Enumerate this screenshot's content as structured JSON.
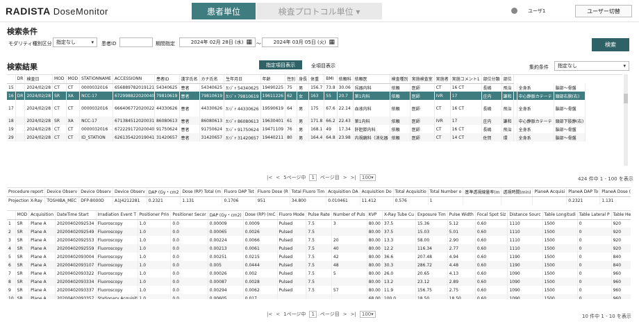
{
  "header": {
    "logo": "RADISTA",
    "product": "DoseMonitor",
    "tabs": [
      {
        "label": "患者単位"
      },
      {
        "label": "検査プロトコル単位 ▾"
      }
    ],
    "user": "ユーザ1",
    "switch_user": "ユーザー切替"
  },
  "search": {
    "title": "検索条件",
    "modality_label": "モダリティ種別区分",
    "modality_value": "指定なし",
    "patient_label": "患者ID",
    "patient_value": "",
    "period_label": "期間指定",
    "date_from": "2024年 02月 28日 (水)",
    "tilde": "〜",
    "date_to": "2024年 03月 05日 (火)",
    "button": "検索"
  },
  "results": {
    "title": "検索結果",
    "show_selected": "指定項目表示",
    "show_all": "全項目表示",
    "agg_label": "集約条件",
    "agg_value": "指定なし"
  },
  "grid1": {
    "headers": [
      "",
      "DR",
      "検査日",
      "MOD",
      "MOD",
      "STATIONNAME",
      "ACCESSIONN",
      "患者ID",
      "漢字氏名",
      "カナ氏名",
      "生年月日",
      "年齢",
      "性別",
      "身長",
      "体重",
      "BMI",
      "依頼科",
      "依頼医",
      "検査種別",
      "実施検査室",
      "実施者",
      "実施コメント1",
      "部位分類",
      "部位"
    ],
    "rows": [
      [
        "15",
        "",
        "2024/02/28",
        "CT",
        "CT",
        "0000032016",
        "656889782019121",
        "54340625",
        "患者",
        "54340625",
        "ｶﾝｼﾞｬ 54340625",
        "19490225",
        "75",
        "男",
        "156.7",
        "73.8",
        "30.06",
        "呉器内科",
        "依頼",
        "医師",
        "CT",
        "16 CT",
        "長嶋",
        "飛治",
        "",
        "全身系",
        "脳部～骨盤"
      ],
      [
        "16",
        "DR",
        "2024/02/28",
        "SR",
        "XA",
        "NCC-17",
        "672998822020040",
        "79810619",
        "患者",
        "79810619",
        "ｶﾝｼﾞｬ 79810619",
        "19611226",
        "62",
        "女",
        "163",
        "55",
        "20.7",
        "第1内科",
        "依頼",
        "医師",
        "IVR",
        "17",
        "庄内",
        "謙和",
        "",
        "中心静脈カテーテ",
        "頸部右腕(右)"
      ],
      [
        "17",
        "",
        "2024/02/28",
        "CT",
        "CT",
        "0000032016",
        "666406772020022",
        "44330626",
        "患者",
        "44330626",
        "ｶﾝｼﾞｬ 44330626",
        "19590619",
        "64",
        "男",
        "175",
        "67.6",
        "22.14",
        "血液内科",
        "依頼",
        "医師",
        "CT",
        "16 CT",
        "長嶋",
        "飛治",
        "",
        "全身系",
        "脳部～骨盤"
      ],
      [
        "18",
        "",
        "2024/02/28",
        "SR",
        "XA",
        "NCC-17",
        "671384512020031",
        "86080613",
        "患者",
        "86080613",
        "ｶﾝｼﾞｬ 86080613",
        "19630401",
        "61",
        "男",
        "171.8",
        "66.2",
        "22.43",
        "第1内科",
        "依頼",
        "医師",
        "IVR",
        "17",
        "庄内",
        "謙和",
        "",
        "中心静脈カテーテ",
        "頸部下肢静(右)"
      ],
      [
        "19",
        "",
        "2024/02/28",
        "CT",
        "CT",
        "0000032016",
        "672229172020040",
        "91750624",
        "患者",
        "91750624",
        "ｶﾝｼﾞｬ 91750624",
        "19471109",
        "76",
        "男",
        "168.1",
        "49",
        "17.34",
        "肝胆膵内科",
        "依頼",
        "医師",
        "CT",
        "16 CT",
        "長嶋",
        "飛治",
        "",
        "全身系",
        "脳部～骨盤"
      ],
      [
        "29",
        "",
        "2024/02/28",
        "CT",
        "CT",
        "ID_STATION",
        "626135422019041",
        "31420657",
        "患者",
        "31420657",
        "ｶﾝｼﾞｬ 31420657",
        "19440211",
        "80",
        "男",
        "164.4",
        "64.8",
        "23.98",
        "内視鏡科（消化器",
        "依頼",
        "医師",
        "CT",
        "14 CT",
        "佐賀",
        "環",
        "",
        "全身系",
        "脳部～骨盤"
      ]
    ]
  },
  "pager1": {
    "page_text": "5ページ中",
    "page_no": "1",
    "page_suffix": "ページ目",
    "per_page": "100",
    "summary": "424 件中 1 - 100 を表示"
  },
  "grid2": {
    "headers": [
      "Procedure report",
      "Device Observ",
      "Device Observ",
      "Device Observ",
      "DAP (Gy・cm2",
      "Dose (RP) Total (m",
      "Fluoro DAP Tot",
      "Fluoro Dose (R",
      "Total Fluoro Tim",
      "Acquisition DA",
      "Acquisition Do",
      "Total Acquisitio",
      "Total Number o",
      "基準透視線量率(m",
      "透視時間(min)",
      "PlaneA Acquisi",
      "PlaneA DAP To",
      "PlaneA Dose (R"
    ],
    "rows": [
      [
        "Projection X-Ray",
        "TOSHIBA_MEC",
        "DFP-8000D",
        "A1J4212281",
        "0.2321",
        "1.131",
        "0.1706",
        "951",
        "34.800",
        "0.010461",
        "11.412",
        "0.576",
        "1",
        "",
        "",
        "",
        "0.2321",
        "1.131"
      ]
    ]
  },
  "grid3": {
    "headers": [
      "",
      "MOD",
      "Acquisition",
      "DateTime Start",
      "Irradiation Event T",
      "Positioner Prin",
      "Positioner Secor",
      "DAP (Gy・cm2)",
      "Dose (RP) (mC",
      "Fluoro Mode",
      "Pulse Rate",
      "Number of Puls",
      "KVP",
      "X-Ray Tube Cu",
      "Exposure Tim",
      "Pulse Width",
      "Focal Spot Siz",
      "Distance Sourc",
      "Table Longitudi",
      "Table Lateral P",
      "Table Height P"
    ],
    "rows": [
      [
        "1",
        "SR",
        "Plane A",
        "20200402092534",
        "Fluoroscopy",
        "1.0",
        "0.0",
        "0.00009",
        "0.0009",
        "Pulsed",
        "7.5",
        "3",
        "80.00",
        "37.5",
        "15.36",
        "5.12",
        "0.60",
        "1110",
        "1500",
        "0",
        "920"
      ],
      [
        "2",
        "SR",
        "Plane A",
        "20200402092549",
        "Fluoroscopy",
        "1.0",
        "0.0",
        "0.00065",
        "0.0026",
        "Pulsed",
        "7.5",
        "",
        "80.00",
        "37.5",
        "15.03",
        "5.01",
        "0.60",
        "1110",
        "1500",
        "0",
        "920"
      ],
      [
        "3",
        "SR",
        "Plane A",
        "20200402092553",
        "Fluoroscopy",
        "1.0",
        "0.0",
        "0.00224",
        "0.0066",
        "Pulsed",
        "7.5",
        "20",
        "80.00",
        "13.3",
        "58.00",
        "2.90",
        "0.60",
        "1110",
        "1500",
        "0",
        "920"
      ],
      [
        "4",
        "SR",
        "Plane A",
        "20200402092559",
        "Fluoroscopy",
        "1.0",
        "0.0",
        "0.00213",
        "0.0061",
        "Pulsed",
        "7.5",
        "40",
        "80.00",
        "12.2",
        "116.34",
        "2.77",
        "0.60",
        "1110",
        "1500",
        "0",
        "920"
      ],
      [
        "5",
        "SR",
        "Plane A",
        "20200402093004",
        "Fluoroscopy",
        "1.0",
        "0.0",
        "0.00251",
        "0.0215",
        "Pulsed",
        "7.5",
        "42",
        "80.00",
        "36.6",
        "207.48",
        "4.94",
        "0.60",
        "1190",
        "1500",
        "0",
        "840"
      ],
      [
        "6",
        "SR",
        "Plane A",
        "20200402093107",
        "Fluoroscopy",
        "1.0",
        "0.0",
        "0.005",
        "0.0444",
        "Pulsed",
        "7.5",
        "48",
        "80.00",
        "30.3",
        "286.72",
        "4.48",
        "0.60",
        "1190",
        "1500",
        "0",
        "840"
      ],
      [
        "7",
        "SR",
        "Plane A",
        "20200402093322",
        "Fluoroscopy",
        "1.0",
        "0.0",
        "0.00026",
        "0.002",
        "Pulsed",
        "7.5",
        "5",
        "80.00",
        "26.0",
        "20.65",
        "4.13",
        "0.60",
        "1090",
        "1500",
        "0",
        "960"
      ],
      [
        "8",
        "SR",
        "Plane A",
        "20200402093334",
        "Fluoroscopy",
        "1.0",
        "0.0",
        "0.00087",
        "0.0028",
        "Pulsed",
        "7.5",
        "",
        "80.00",
        "13.2",
        "23.12",
        "2.89",
        "0.60",
        "1090",
        "1500",
        "0",
        "960"
      ],
      [
        "9",
        "SR",
        "Plane A",
        "20200402093337",
        "Fluoroscopy",
        "1.0",
        "0.0",
        "0.00294",
        "0.0062",
        "Pulsed",
        "7.5",
        "57",
        "80.00",
        "11.9",
        "156.75",
        "2.75",
        "0.60",
        "1090",
        "1500",
        "0",
        "960"
      ],
      [
        "10",
        "SR",
        "Plane A",
        "20200402093357",
        "Stationary Acquisition",
        "1.0",
        "0.0",
        "0.00605",
        "0.017",
        "",
        "",
        "",
        "68.00",
        "100.0",
        "18.50",
        "18.50",
        "0.60",
        "1090",
        "1500",
        "0",
        "960"
      ]
    ]
  },
  "pager2": {
    "page_text": "1ページ中",
    "page_no": "1",
    "page_suffix": "ページ目",
    "per_page": "100",
    "summary": "10 件中 1 - 10 を表示"
  }
}
